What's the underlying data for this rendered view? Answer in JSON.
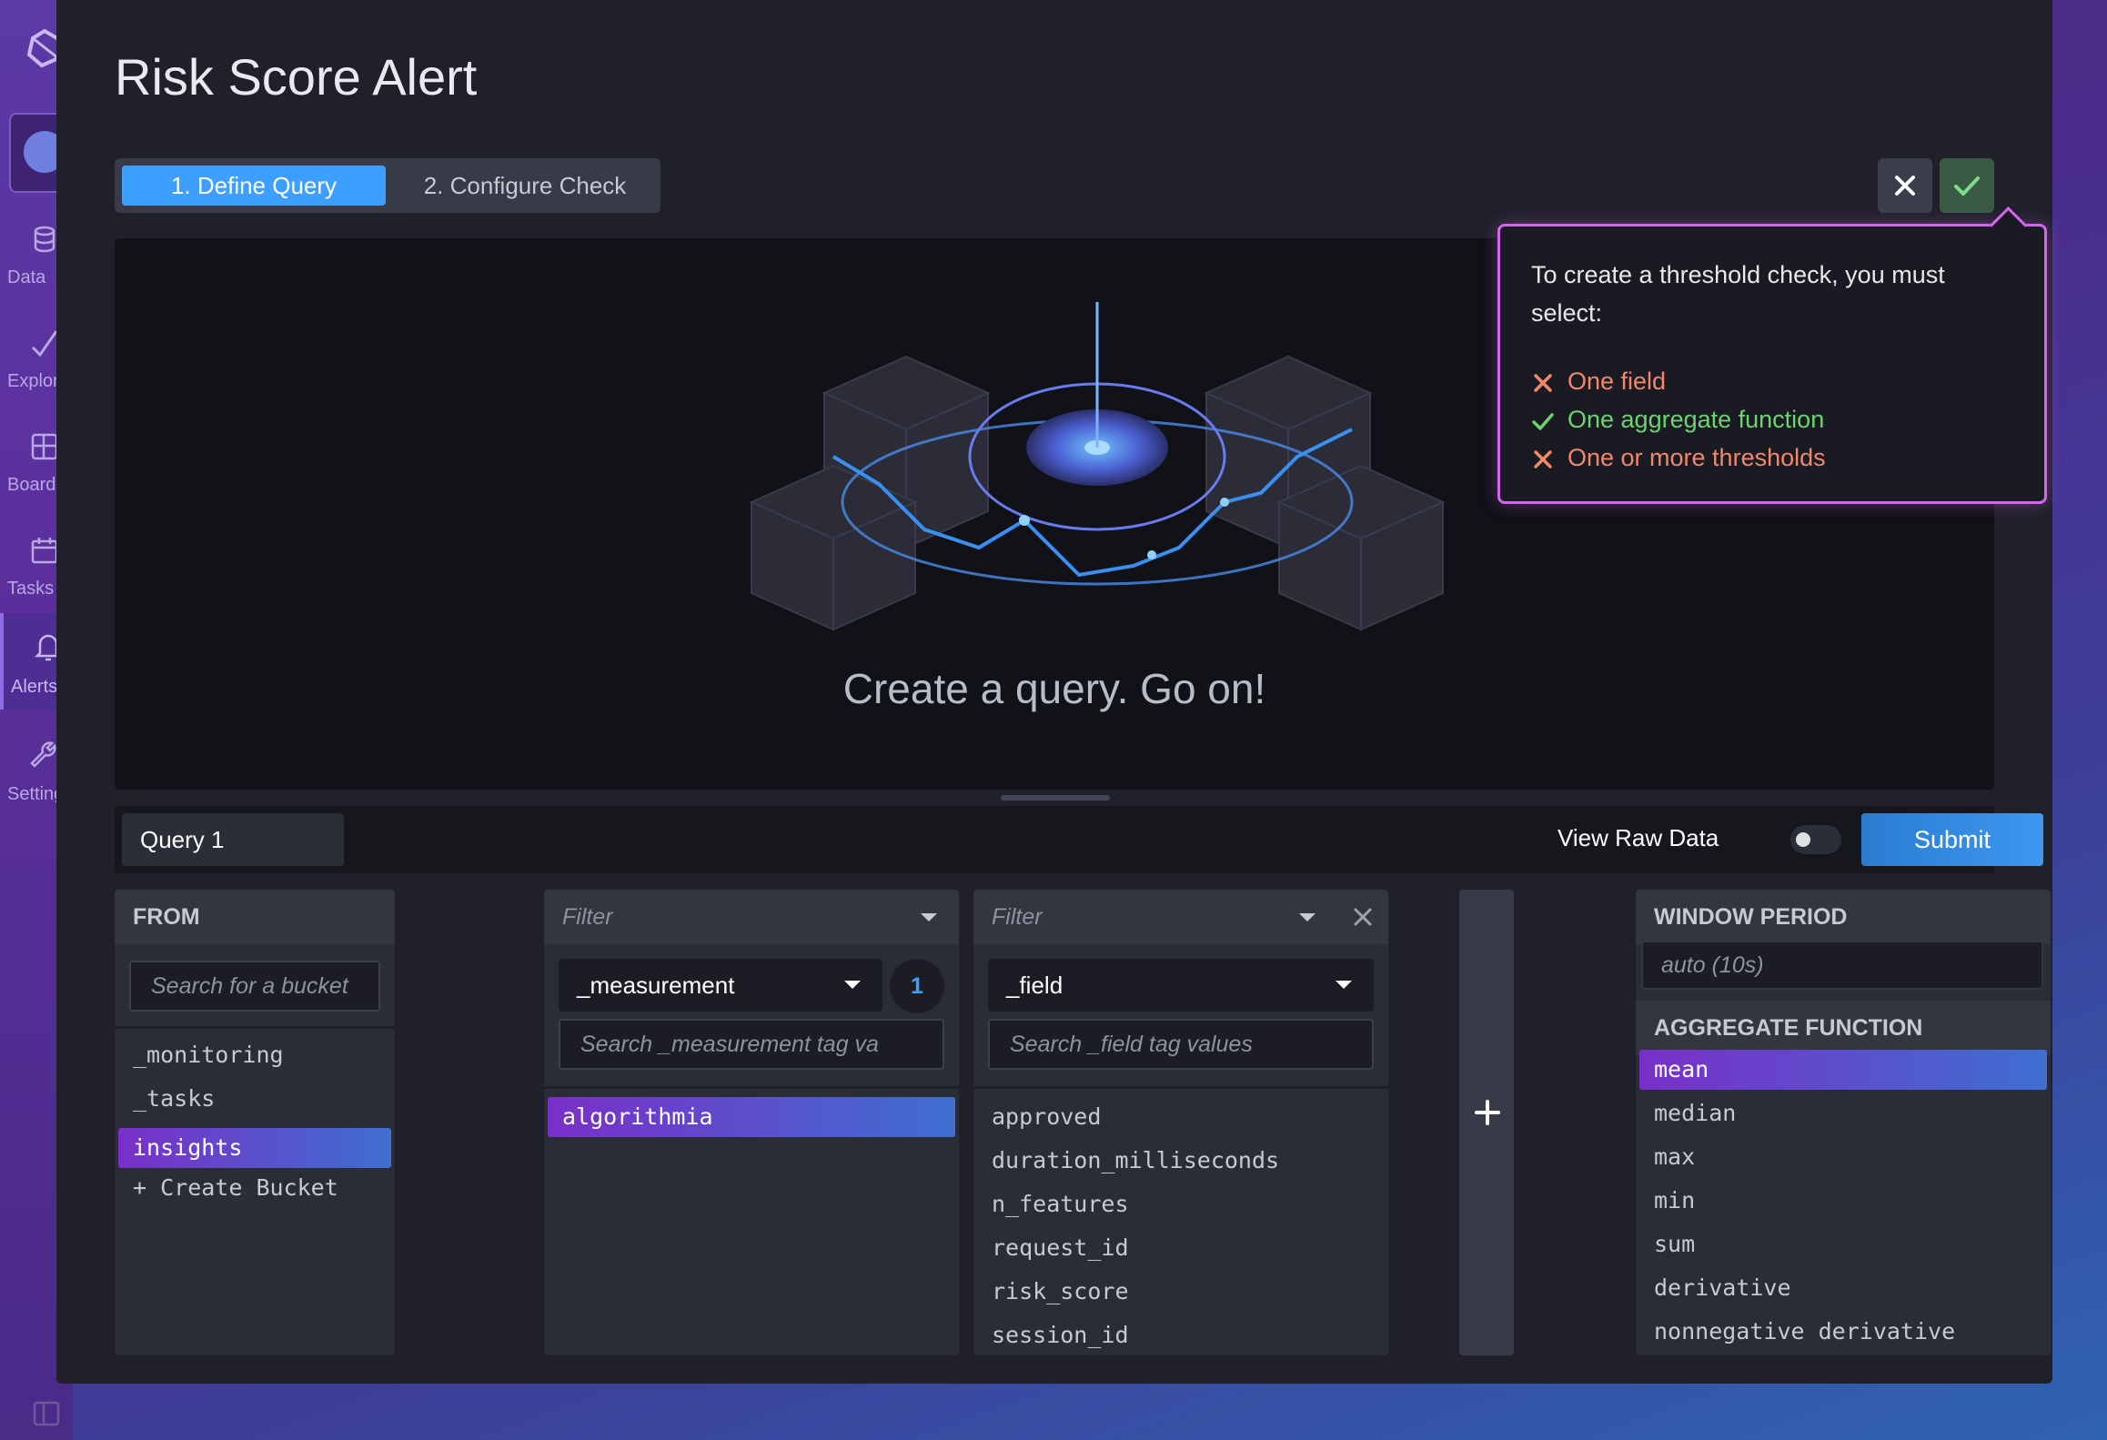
{
  "nav": {
    "items": [
      {
        "label": "Data",
        "icon": "database-icon"
      },
      {
        "label": "Explore",
        "icon": "graph-icon"
      },
      {
        "label": "Boards",
        "icon": "dashboard-icon"
      },
      {
        "label": "Tasks",
        "icon": "calendar-icon"
      },
      {
        "label": "Alerts",
        "icon": "bell-icon"
      },
      {
        "label": "Settings",
        "icon": "wrench-icon"
      }
    ]
  },
  "overlay": {
    "title": "Risk Score Alert",
    "tabs": [
      {
        "label": "1. Define Query",
        "active": true
      },
      {
        "label": "2. Configure Check",
        "active": false
      }
    ]
  },
  "graph": {
    "empty_message": "Create a query. Go on!"
  },
  "popover": {
    "message": "To create a threshold check, you must select:",
    "requirements": [
      {
        "label": "One field",
        "met": false
      },
      {
        "label": "One aggregate function",
        "met": true
      },
      {
        "label": "One or more thresholds",
        "met": false
      }
    ]
  },
  "query_bar": {
    "tab_label": "Query 1",
    "view_raw_label": "View Raw Data",
    "view_raw_on": false,
    "submit_label": "Submit"
  },
  "from": {
    "header": "FROM",
    "search_placeholder": "Search for a bucket",
    "buckets": [
      "_monitoring",
      "_tasks",
      "insights",
      "+ Create Bucket"
    ],
    "selected": "insights"
  },
  "filter1": {
    "header": "Filter",
    "key": "_measurement",
    "count": "1",
    "search_placeholder": "Search _measurement tag va",
    "values": [
      "algorithmia"
    ],
    "selected": "algorithmia"
  },
  "filter2": {
    "header": "Filter",
    "key": "_field",
    "search_placeholder": "Search _field tag values",
    "values": [
      "approved",
      "duration_milliseconds",
      "n_features",
      "request_id",
      "risk_score",
      "session_id"
    ]
  },
  "aggregate": {
    "window_header": "WINDOW PERIOD",
    "window_placeholder": "auto (10s)",
    "function_header": "AGGREGATE FUNCTION",
    "functions": [
      "mean",
      "median",
      "max",
      "min",
      "sum",
      "derivative",
      "nonnegative derivative"
    ],
    "selected": "mean"
  },
  "colors": {
    "accent_blue": "#3d9fff",
    "selected_gradient_start": "#7a2fc8",
    "selected_gradient_end": "#3d6fd0",
    "popover_border": "#d564ee",
    "fail": "#f2876a",
    "ok": "#6bd36f"
  }
}
